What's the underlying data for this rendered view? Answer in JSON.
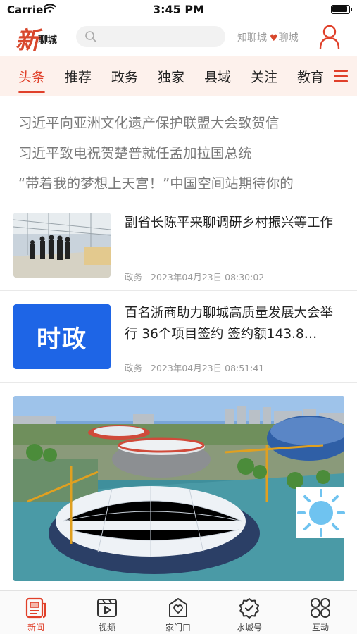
{
  "status_bar": {
    "carrier": "Carrier",
    "time": "3:45 PM"
  },
  "header": {
    "logo_char": "新",
    "logo_text": "聊城",
    "slogan_left": "知聊城",
    "slogan_right": "聊城",
    "search_icon": "search-icon",
    "user_icon": "user-icon"
  },
  "tabs": [
    {
      "label": "头条",
      "active": true
    },
    {
      "label": "推荐"
    },
    {
      "label": "政务"
    },
    {
      "label": "独家"
    },
    {
      "label": "县域"
    },
    {
      "label": "关注"
    },
    {
      "label": "教育"
    }
  ],
  "headlines": [
    "习近平向亚洲文化遗产保护联盟大会致贺信",
    "习近平致电祝贺楚普就任孟加拉国总统",
    "“带着我的梦想上天宫！”中国空间站期待你的"
  ],
  "news": [
    {
      "title": "副省长陈平来聊调研乡村振兴等工作",
      "category": "政务",
      "time": "2023年04月23日 08:30:02"
    },
    {
      "title": "百名浙商助力聊城高质量发展大会举行 36个项目签约 签约额143.8…",
      "thumb_text": "时政",
      "category": "政务",
      "time": "2023年04月23日 08:51:41"
    }
  ],
  "weather_icon": "sun-icon",
  "tabbar": [
    {
      "label": "新闻",
      "icon": "news-icon",
      "active": true
    },
    {
      "label": "视频",
      "icon": "video-icon"
    },
    {
      "label": "家门口",
      "icon": "home-heart-icon"
    },
    {
      "label": "水城号",
      "icon": "badge-check-icon"
    },
    {
      "label": "互动",
      "icon": "grid-icon"
    }
  ],
  "colors": {
    "accent": "#e0402a",
    "tab_bg": "#fdf1ec",
    "shizheng_blue": "#1e65e6"
  }
}
